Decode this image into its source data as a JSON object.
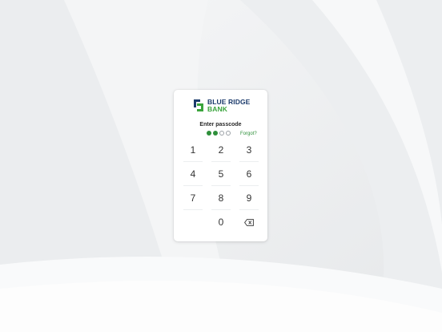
{
  "brand": {
    "line1": "BLUE RIDGE",
    "line2": "BANK",
    "colors": {
      "navy": "#1b3a6b",
      "green": "#3aa43c"
    }
  },
  "passcode": {
    "prompt": "Enter passcode",
    "length": 4,
    "filled": 2,
    "forgot_label": "Forgot?"
  },
  "keypad": {
    "keys": [
      "1",
      "2",
      "3",
      "4",
      "5",
      "6",
      "7",
      "8",
      "9",
      "",
      "0",
      "backspace-icon"
    ]
  },
  "colors": {
    "accent": "#2e8f3a"
  }
}
